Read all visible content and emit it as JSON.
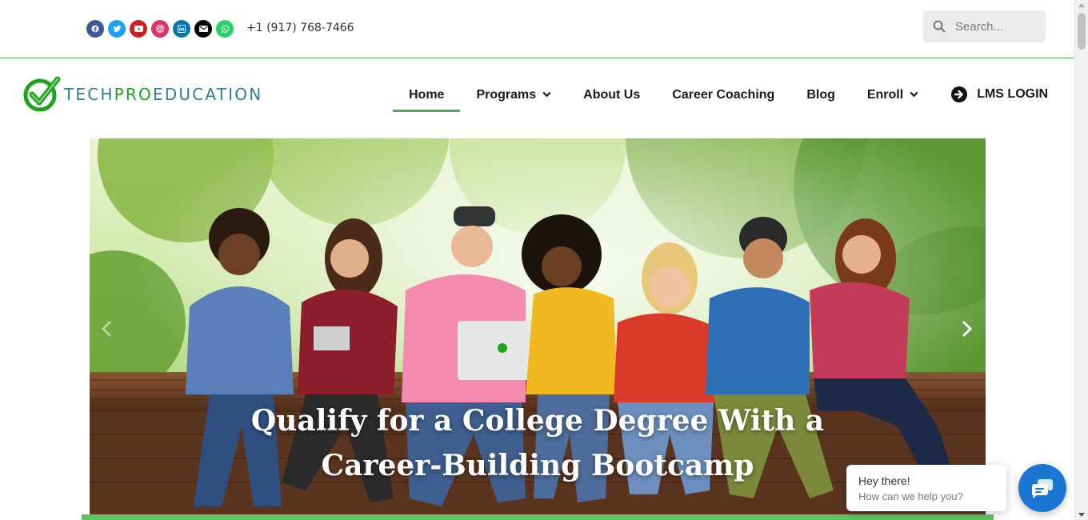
{
  "topbar": {
    "socials": [
      {
        "icon": "facebook-icon",
        "color": "#3b5998"
      },
      {
        "icon": "twitter-icon",
        "color": "#1da1f2"
      },
      {
        "icon": "youtube-icon",
        "color": "#cd201f"
      },
      {
        "icon": "instagram-icon",
        "color": "#e1306c"
      },
      {
        "icon": "linkedin-icon",
        "color": "#0077b5"
      },
      {
        "icon": "envelope-icon",
        "color": "#000000"
      },
      {
        "icon": "whatsapp-icon",
        "color": "#25d366"
      }
    ],
    "phone": "+1 (917) 768-7466",
    "search_placeholder": "Search..."
  },
  "logo": {
    "part1": "TECH",
    "part2": "PRO",
    "part3": "EDUCATION",
    "colors": {
      "tech": "#2e7d9a",
      "pro": "#1aa51a",
      "education": "#2e7d9a",
      "check": "#1aa51a"
    }
  },
  "nav": {
    "items": [
      {
        "label": "Home",
        "active": true,
        "dropdown": false
      },
      {
        "label": "Programs",
        "active": false,
        "dropdown": true
      },
      {
        "label": "About Us",
        "active": false,
        "dropdown": false
      },
      {
        "label": "Career Coaching",
        "active": false,
        "dropdown": false
      },
      {
        "label": "Blog",
        "active": false,
        "dropdown": false
      },
      {
        "label": "Enroll",
        "active": false,
        "dropdown": true
      }
    ],
    "lms_label": "LMS LOGIN"
  },
  "hero": {
    "title_line1": "Qualify for a College Degree With a",
    "title_line2": "Career-Building Bootcamp"
  },
  "chat": {
    "title": "Hey there!",
    "subtitle": "How can we help you?",
    "accent": "#1976d2"
  },
  "accent": "#4caf50"
}
